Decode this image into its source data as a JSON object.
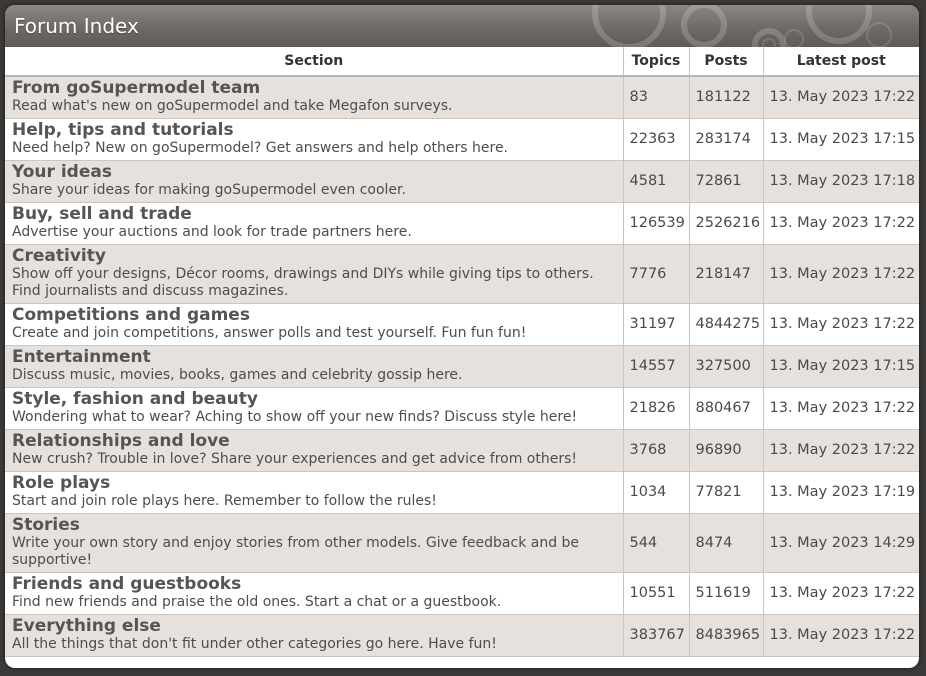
{
  "header": {
    "title": "Forum Index"
  },
  "columns": {
    "section": "Section",
    "topics": "Topics",
    "posts": "Posts",
    "latest": "Latest post"
  },
  "rows": [
    {
      "name": "From goSupermodel team",
      "desc": "Read what's new on goSupermodel and take Megafon surveys.",
      "topics": "83",
      "posts": "181122",
      "latest": "13. May 2023 17:22"
    },
    {
      "name": "Help, tips and tutorials",
      "desc": "Need help? New on goSupermodel? Get answers and help others here.",
      "topics": "22363",
      "posts": "283174",
      "latest": "13. May 2023 17:15"
    },
    {
      "name": "Your ideas",
      "desc": "Share your ideas for making goSupermodel even cooler.",
      "topics": "4581",
      "posts": "72861",
      "latest": "13. May 2023 17:18"
    },
    {
      "name": "Buy, sell and trade",
      "desc": "Advertise your auctions and look for trade partners here.",
      "topics": "126539",
      "posts": "2526216",
      "latest": "13. May 2023 17:22"
    },
    {
      "name": "Creativity",
      "desc": "Show off your designs, Décor rooms, drawings and DIYs while giving tips to others. Find journalists and discuss magazines.",
      "topics": "7776",
      "posts": "218147",
      "latest": "13. May 2023 17:22"
    },
    {
      "name": "Competitions and games",
      "desc": "Create and join competitions, answer polls and test yourself. Fun fun fun!",
      "topics": "31197",
      "posts": "4844275",
      "latest": "13. May 2023 17:22"
    },
    {
      "name": "Entertainment",
      "desc": "Discuss music, movies, books, games and celebrity gossip here.",
      "topics": "14557",
      "posts": "327500",
      "latest": "13. May 2023 17:15"
    },
    {
      "name": "Style, fashion and beauty",
      "desc": "Wondering what to wear? Aching to show off your new finds? Discuss style here!",
      "topics": "21826",
      "posts": "880467",
      "latest": "13. May 2023 17:22"
    },
    {
      "name": "Relationships and love",
      "desc": "New crush? Trouble in love? Share your experiences and get advice from others!",
      "topics": "3768",
      "posts": "96890",
      "latest": "13. May 2023 17:22"
    },
    {
      "name": "Role plays",
      "desc": "Start and join role plays here. Remember to follow the rules!",
      "topics": "1034",
      "posts": "77821",
      "latest": "13. May 2023 17:19"
    },
    {
      "name": "Stories",
      "desc": "Write your own story and enjoy stories from other models. Give feedback and be supportive!",
      "topics": "544",
      "posts": "8474",
      "latest": "13. May 2023 14:29"
    },
    {
      "name": "Friends and guestbooks",
      "desc": "Find new friends and praise the old ones. Start a chat or a guestbook.",
      "topics": "10551",
      "posts": "511619",
      "latest": "13. May 2023 17:22"
    },
    {
      "name": "Everything else",
      "desc": "All the things that don't fit under other categories go here. Have fun!",
      "topics": "383767",
      "posts": "8483965",
      "latest": "13. May 2023 17:22"
    }
  ]
}
